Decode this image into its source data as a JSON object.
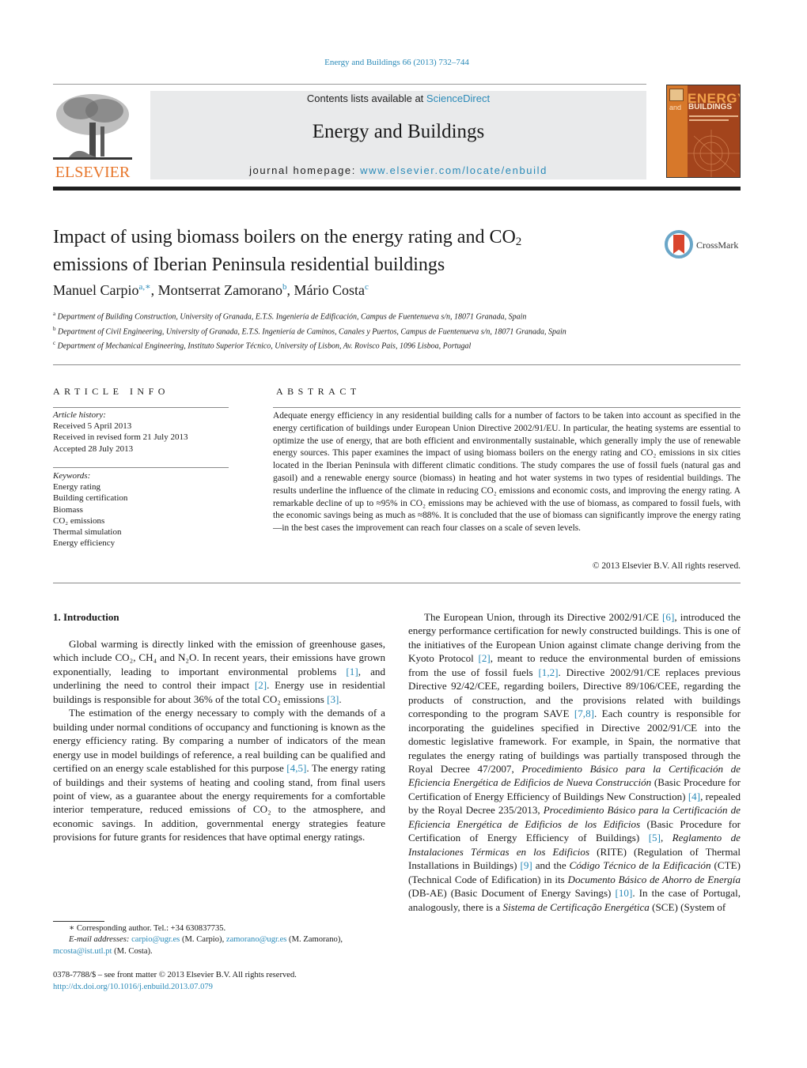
{
  "header": {
    "journal_ref": "Energy and Buildings 66 (2013) 732–744",
    "contents_prefix": "Contents lists available at ",
    "contents_link": "ScienceDirect",
    "journal_title": "Energy and Buildings",
    "homepage_prefix": "journal homepage: ",
    "homepage_link": "www.elsevier.com/locate/enbuild",
    "publisher_logo": "ELSEVIER",
    "cover": {
      "line1": "ENERGY",
      "line2_small": "and",
      "line2": "BUILDINGS"
    },
    "colors": {
      "link": "#2a8ab8",
      "elsevier_orange": "#e7762b",
      "cover_bg": "#a3441c"
    }
  },
  "article": {
    "title_part1": "Impact of using biomass boilers on the energy rating and CO",
    "title_sub": "2",
    "title_part2": "emissions of Iberian Peninsula residential buildings",
    "crossmark_label": "CrossMark",
    "authors": [
      {
        "name": "Manuel Carpio",
        "sup": "a,∗"
      },
      {
        "name": "Montserrat Zamorano",
        "sup": "b"
      },
      {
        "name": "Mário Costa",
        "sup": "c"
      }
    ],
    "affiliations": [
      {
        "mark": "a",
        "text": "Department of Building Construction, University of Granada, E.T.S. Ingeniería de Edificación, Campus de Fuentenueva s/n, 18071 Granada, Spain"
      },
      {
        "mark": "b",
        "text": "Department of Civil Engineering, University of Granada, E.T.S. Ingeniería de Caminos, Canales y Puertos, Campus de Fuentenueva s/n, 18071 Granada, Spain"
      },
      {
        "mark": "c",
        "text": "Department of Mechanical Engineering, Instituto Superior Técnico, University of Lisbon, Av. Rovisco Pais, 1096 Lisboa, Portugal"
      }
    ]
  },
  "article_info": {
    "heading": "ARTICLE INFO",
    "history_label": "Article history:",
    "history": [
      "Received 5 April 2013",
      "Received in revised form 21 July 2013",
      "Accepted 28 July 2013"
    ],
    "keywords_label": "Keywords:",
    "keywords": [
      "Energy rating",
      "Building certification",
      "Biomass",
      "CO₂ emissions",
      "Thermal simulation",
      "Energy efficiency"
    ]
  },
  "abstract": {
    "heading": "ABSTRACT",
    "text": "Adequate energy efficiency in any residential building calls for a number of factors to be taken into account as specified in the energy certification of buildings under European Union Directive 2002/91/EU. In particular, the heating systems are essential to optimize the use of energy, that are both efficient and environmentally sustainable, which generally imply the use of renewable energy sources. This paper examines the impact of using biomass boilers on the energy rating and CO₂ emissions in six cities located in the Iberian Peninsula with different climatic conditions. The study compares the use of fossil fuels (natural gas and gasoil) and a renewable energy source (biomass) in heating and hot water systems in two types of residential buildings. The results underline the influence of the climate in reducing CO₂ emissions and economic costs, and improving the energy rating. A remarkable decline of up to ≈95% in CO₂ emissions may be achieved with the use of biomass, as compared to fossil fuels, with the economic savings being as much as ≈88%. It is concluded that the use of biomass can significantly improve the energy rating—in the best cases the improvement can reach four classes on a scale of seven levels.",
    "copyright": "© 2013 Elsevier B.V. All rights reserved."
  },
  "body": {
    "section_heading": "1.  Introduction",
    "left_paragraphs": [
      [
        {
          "t": "Global warming is directly linked with the emission of greenhouse gases, which include CO₂, CH₄ and N₂O. In recent years, their emissions have grown exponentially, leading to important environmental problems "
        },
        {
          "ref": "[1]"
        },
        {
          "t": ", and underlining the need to control their impact "
        },
        {
          "ref": "[2]"
        },
        {
          "t": ". Energy use in residential buildings is responsible for about 36% of the total CO₂ emissions "
        },
        {
          "ref": "[3]"
        },
        {
          "t": "."
        }
      ],
      [
        {
          "t": "The estimation of the energy necessary to comply with the demands of a building under normal conditions of occupancy and functioning is known as the energy efficiency rating. By comparing a number of indicators of the mean energy use in model buildings of reference, a real building can be qualified and certified on an energy scale established for this purpose "
        },
        {
          "ref": "[4,5]"
        },
        {
          "t": ". The energy rating of buildings and their systems of heating and cooling stand, from final users point of view, as a guarantee about the energy requirements for a comfortable interior temperature, reduced emissions of CO₂ to the atmosphere, and economic savings. In addition, governmental energy strategies feature provisions for future grants for residences that have optimal energy ratings."
        }
      ]
    ],
    "right_paragraphs": [
      [
        {
          "t": "The European Union, through its Directive 2002/91/CE "
        },
        {
          "ref": "[6]"
        },
        {
          "t": ", introduced the energy performance certification for newly constructed buildings. This is one of the initiatives of the European Union against climate change deriving from the Kyoto Protocol "
        },
        {
          "ref": "[2]"
        },
        {
          "t": ", meant to reduce the environmental burden of emissions from the use of fossil fuels "
        },
        {
          "ref": "[1,2]"
        },
        {
          "t": ". Directive 2002/91/CE replaces previous Directive 92/42/CEE, regarding boilers, Directive 89/106/CEE, regarding the products of construction, and the provisions related with buildings corresponding to the program SAVE "
        },
        {
          "ref": "[7,8]"
        },
        {
          "t": ". Each country is responsible for incorporating the guidelines specified in Directive 2002/91/CE into the domestic legislative framework. For example, in Spain, the normative that regulates the energy rating of buildings was partially transposed through the Royal Decree 47/2007, "
        },
        {
          "i": "Procedimiento Básico para la Certificación de Eficiencia Energética de Edificios de Nueva Construcción"
        },
        {
          "t": " (Basic Procedure for Certification of Energy Efficiency of Buildings New Construction) "
        },
        {
          "ref": "[4]"
        },
        {
          "t": ", repealed by the Royal Decree 235/2013, "
        },
        {
          "i": "Procedimiento Básico para la Certificación de Eficiencia Energética de Edificios de los Edificios"
        },
        {
          "t": " (Basic Procedure for Certification of Energy Efficiency of Buildings) "
        },
        {
          "ref": "[5]"
        },
        {
          "t": ", "
        },
        {
          "i": "Reglamento de Instalaciones Térmicas en los Edificios"
        },
        {
          "t": " (RITE) (Regulation of Thermal Installations in Buildings) "
        },
        {
          "ref": "[9]"
        },
        {
          "t": " and the "
        },
        {
          "i": "Código Técnico de la Edificación"
        },
        {
          "t": " (CTE) (Technical Code of Edification) in its "
        },
        {
          "i": "Documento Básico de Ahorro de Energía"
        },
        {
          "t": " (DB-AE) (Basic Document of Energy Savings) "
        },
        {
          "ref": "[10]"
        },
        {
          "t": ". In the case of Portugal, analogously, there is a "
        },
        {
          "i": "Sistema de Certificação Energética"
        },
        {
          "t": " (SCE) (System of"
        }
      ]
    ]
  },
  "footnote": {
    "corresponding": "∗  Corresponding author. Tel.: +34 630837735.",
    "email_label": "E-mail addresses: ",
    "emails": [
      {
        "addr": "carpio@ugr.es",
        "who": " (M. Carpio), "
      },
      {
        "addr": "zamorano@ugr.es",
        "who": " (M. Zamorano), "
      },
      {
        "addr": "mcosta@ist.utl.pt",
        "who": " (M. Costa)."
      }
    ],
    "issn": "0378-7788/$ – see front matter © 2013 Elsevier B.V. All rights reserved.",
    "doi": "http://dx.doi.org/10.1016/j.enbuild.2013.07.079"
  }
}
